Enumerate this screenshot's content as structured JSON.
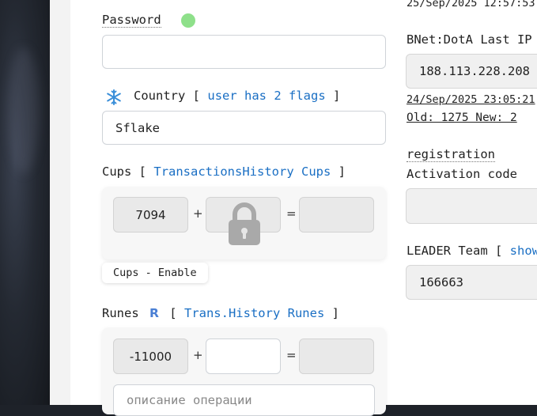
{
  "left": {
    "password": {
      "label": "Password",
      "value": ""
    },
    "country": {
      "label": "Country",
      "bracket_open": "[",
      "link": "user has 2 flags",
      "bracket_close": "]",
      "value": "Sflake",
      "icon": "snowflake-icon"
    },
    "cups": {
      "label": "Cups",
      "bracket_open": "[",
      "link": "TransactionsHistory Cups",
      "bracket_close": "]",
      "current": "7094",
      "plus": "+",
      "equals": "=",
      "add": "",
      "result": "",
      "enable_label": "Cups - Enable",
      "lock_icon": "lock-icon"
    },
    "runes": {
      "label": "Runes",
      "icon_glyph": "R",
      "bracket_open": "[",
      "link": "Trans.History Runes",
      "bracket_close": "]",
      "current": "-11000",
      "plus": "+",
      "equals": "=",
      "add": "",
      "result": "",
      "description_placeholder": "описание операции"
    }
  },
  "right": {
    "top_date": "25/Sep/2025 12:57:53",
    "bnet": {
      "label": "BNet:DotA Last IP",
      "ip": "188.113.228.208",
      "date": "24/Sep/2025 23:05:21",
      "old_new": "Old: 1275 New: 2"
    },
    "registration": {
      "label": "registration",
      "activation_label": "Activation code",
      "activation_value": ""
    },
    "leader": {
      "label": "LEADER Team [",
      "link": "show",
      "value": "166663"
    }
  },
  "colors": {
    "link": "#1a6fc4",
    "status": "#8ee08a"
  }
}
